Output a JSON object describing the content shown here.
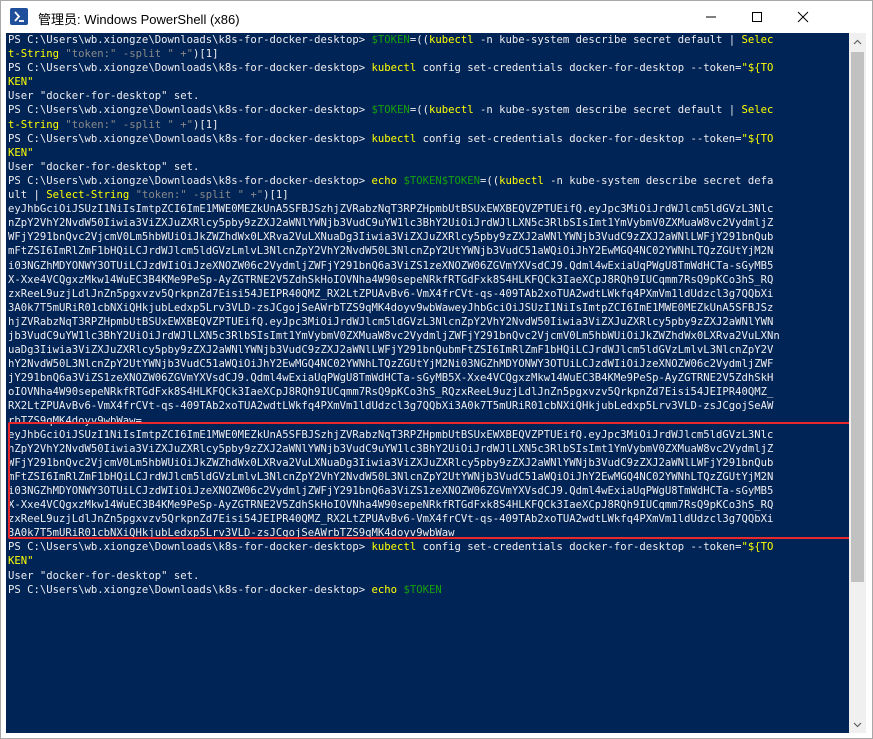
{
  "window": {
    "title": "管理员: Windows PowerShell (x86)",
    "icon": "powershell-icon"
  },
  "titlebar_buttons": [
    "minimize-icon",
    "maximize-icon",
    "close-icon"
  ],
  "console": {
    "prompt": "PS C:\\Users\\wb.xiongze\\Downloads\\k8s-for-docker-desktop>",
    "lines": [
      [
        {
          "t": "PS C:\\Users\\wb.xiongze\\Downloads\\k8s-for-docker-desktop> ",
          "c": "w"
        },
        {
          "t": "$TOKEN",
          "c": "g"
        },
        {
          "t": "=((",
          "c": "w"
        },
        {
          "t": "kubectl",
          "c": "y"
        },
        {
          "t": " -n kube-system describe secret default | ",
          "c": "w"
        },
        {
          "t": "Selec",
          "c": "y"
        }
      ],
      [
        {
          "t": "t-String",
          "c": "y"
        },
        {
          "t": " \"token:\"",
          "c": "gray"
        },
        {
          "t": " -split ",
          "c": "gray"
        },
        {
          "t": "\" +\"",
          "c": "gray"
        },
        {
          "t": ")[1]",
          "c": "w"
        }
      ],
      [
        {
          "t": "PS C:\\Users\\wb.xiongze\\Downloads\\k8s-for-docker-desktop> ",
          "c": "w"
        },
        {
          "t": "kubectl",
          "c": "y"
        },
        {
          "t": " config set-credentials docker-for-desktop --token=",
          "c": "w"
        },
        {
          "t": "\"${TO",
          "c": "y"
        }
      ],
      [
        {
          "t": "KEN",
          "c": "y"
        },
        {
          "t": "\"",
          "c": "y"
        }
      ],
      [
        {
          "t": "User \"docker-for-desktop\" set.",
          "c": "w"
        }
      ],
      [
        {
          "t": "PS C:\\Users\\wb.xiongze\\Downloads\\k8s-for-docker-desktop> ",
          "c": "w"
        },
        {
          "t": "$TOKEN",
          "c": "g"
        },
        {
          "t": "=((",
          "c": "w"
        },
        {
          "t": "kubectl",
          "c": "y"
        },
        {
          "t": " -n kube-system describe secret default | ",
          "c": "w"
        },
        {
          "t": "Selec",
          "c": "y"
        }
      ],
      [
        {
          "t": "t-String",
          "c": "y"
        },
        {
          "t": " \"token:\"",
          "c": "gray"
        },
        {
          "t": " -split ",
          "c": "gray"
        },
        {
          "t": "\" +\"",
          "c": "gray"
        },
        {
          "t": ")[1]",
          "c": "w"
        }
      ],
      [
        {
          "t": "PS C:\\Users\\wb.xiongze\\Downloads\\k8s-for-docker-desktop> ",
          "c": "w"
        },
        {
          "t": "kubectl",
          "c": "y"
        },
        {
          "t": " config set-credentials docker-for-desktop --token=",
          "c": "w"
        },
        {
          "t": "\"${TO",
          "c": "y"
        }
      ],
      [
        {
          "t": "KEN",
          "c": "y"
        },
        {
          "t": "\"",
          "c": "y"
        }
      ],
      [
        {
          "t": "User \"docker-for-desktop\" set.",
          "c": "w"
        }
      ],
      [
        {
          "t": "PS C:\\Users\\wb.xiongze\\Downloads\\k8s-for-docker-desktop> ",
          "c": "w"
        },
        {
          "t": "echo ",
          "c": "y"
        },
        {
          "t": "$TOKEN$TOKEN",
          "c": "g"
        },
        {
          "t": "=((",
          "c": "w"
        },
        {
          "t": "kubectl",
          "c": "y"
        },
        {
          "t": " -n kube-system describe secret defa",
          "c": "w"
        }
      ],
      [
        {
          "t": "ult | ",
          "c": "w"
        },
        {
          "t": "Select-String",
          "c": "y"
        },
        {
          "t": " \"token:\"",
          "c": "gray"
        },
        {
          "t": " -split ",
          "c": "gray"
        },
        {
          "t": "\" +\"",
          "c": "gray"
        },
        {
          "t": ")[1]",
          "c": "w"
        }
      ],
      [
        {
          "t": "eyJhbGciOiJSUzI1NiIsImtpZCI6ImE1MWE0MEZkUnA5SFBJSzhjZVRabzNqT3RPZHpmbUtBSUxEWXBEQVZPTUEifQ.eyJpc3MiOiJrdWJlcm5ldGVzL3Nlc",
          "c": "w"
        }
      ],
      [
        {
          "t": "nZpY2VhY2NvdW50Iiwia3ViZXJuZXRlcy5pby9zZXJ2aWNlYWNjb3VudC9uYW1lc3BhY2UiOiJrdWJlLXN5c3RlbSIsImt1YmVybmV0ZXMuaW8vc2VydmljZ",
          "c": "w"
        }
      ],
      [
        {
          "t": "WFjY291bnQvc2VjcmV0Lm5hbWUiOiJkZWZhdWx0LXRva2VuLXNuaDg3Iiwia3ViZXJuZXRlcy5pby9zZXJ2aWNlYWNjb3VudC9zZXJ2aWNlLWFjY291bnQub",
          "c": "w"
        }
      ],
      [
        {
          "t": "mFtZSI6ImRlZmF1bHQiLCJrdWJlcm5ldGVzLmlvL3NlcnZpY2VhY2NvdW50L3NlcnZpY2UtYWNjb3VudC51aWQiOiJhY2EwMGQ4NC02YWNhLTQzZGUtYjM2N",
          "c": "w"
        }
      ],
      [
        {
          "t": "i03NGZhMDYONWY3OTUiLCJzdWIiOiJzeXNOZW06c2VydmljZWFjY291bnQ6a3ViZS1zeXNOZW06ZGVmYXVsdCJ9.Qdml4wExiaUqPWgU8TmWdHCTa-sGyMB5",
          "c": "w"
        }
      ],
      [
        {
          "t": "X-Xxe4VCQgxzMkw14WuEC3B4KMe9PeSp-AyZGTRNE2V5ZdhSkHoIOVNha4W90sepeNRkfRTGdFxk8S4HLKFQCk3IaeXCpJ8RQh9IUCqmm7RsQ9pKCo3hS_RQ",
          "c": "w"
        }
      ],
      [
        {
          "t": "zxReeL9uzjLdlJnZn5pgxvzv5QrkpnZd7Eisi54JEIPR40QMZ_RX2LtZPUAvBv6-VmX4frCVt-qs-409TAb2xoTUA2wdtLWkfq4PXmVm1ldUdzcl3g7QQbXi",
          "c": "w"
        }
      ],
      [
        {
          "t": "3A0k7T5mURiR01cbNXiQHkjubLedxp5Lrv3VLD-zsJCgojSeAWrbTZS9qMK4doyv9wbWaweyJhbGciOiJSUzI1NiIsImtpZCI6ImE1MWE0MEZkUnA5SFBJSz",
          "c": "w"
        }
      ],
      [
        {
          "t": "hjZVRabzNqT3RPZHpmbUtBSUxEWXBEQVZPTUEifQ.eyJpc3MiOiJrdWJlcm5ldGVzL3NlcnZpY2VhY2NvdW50Iiwia3ViZXJuZXRlcy5pby9zZXJ2aWNlYWN",
          "c": "w"
        }
      ],
      [
        {
          "t": "jb3VudC9uYW1lc3BhY2UiOiJrdWJlLXN5c3RlbSIsImt1YmVybmV0ZXMuaW8vc2VydmljZWFjY291bnQvc2VjcmV0Lm5hbWUiOiJkZWZhdWx0LXRva2VuLXNn",
          "c": "w"
        }
      ],
      [
        {
          "t": "uaDg3Iiwia3ViZXJuZXRlcy5pby9zZXJ2aWNlYWNjb3VudC9zZXJ2aWNlLWFjY291bnQubmFtZSI6ImRlZmF1bHQiLCJrdWJlcm5ldGVzLmlvL3NlcnZpY2V",
          "c": "w"
        }
      ],
      [
        {
          "t": "hY2NvdW50L3NlcnZpY2UtYWNjb3VudC51aWQiOiJhY2EwMGQ4NC02YWNhLTQzZGUtYjM2Ni03NGZhMDYONWY3OTUiLCJzdWIiOiJzeXNOZW06c2VydmljZWF",
          "c": "w"
        }
      ],
      [
        {
          "t": "jY291bnQ6a3ViZS1zeXNOZW06ZGVmYXVsdCJ9.Qdml4wExiaUqPWgU8TmWdHCTa-sGyMB5X-Xxe4VCQgxzMkw14WuEC3B4KMe9PeSp-AyZGTRNE2V5ZdhSkH",
          "c": "w"
        }
      ],
      [
        {
          "t": "oIOVNha4W90sepeNRkfRTGdFxk8S4HLKFQCk3IaeXCpJ8RQh9IUCqmm7RsQ9pKCo3hS_RQzxReeL9uzjLdlJnZn5pgxvzv5QrkpnZd7Eisi54JEIPR40QMZ_",
          "c": "w"
        }
      ],
      [
        {
          "t": "RX2LtZPUAvBv6-VmX4frCVt-qs-409TAb2xoTUA2wdtLWkfq4PXmVm1ldUdzcl3g7QQbXi3A0k7T5mURiR01cbNXiQHkjubLedxp5Lrv3VLD-zsJCgojSeAW",
          "c": "w"
        }
      ],
      [
        {
          "t": "rbTZS9qMK4doyv9wbWaw=",
          "c": "w"
        }
      ],
      [
        {
          "t": "eyJhbGciOiJSUzI1NiIsImtpZCI6ImE1MWE0MEZkUnA5SFBJSzhjZVRabzNqT3RPZHpmbUtBSUxEWXBEQVZPTUEifQ.eyJpc3MiOiJrdWJlcm5ldGVzL3Nlc",
          "c": "w"
        }
      ],
      [
        {
          "t": "nZpY2VhY2NvdW50Iiwia3ViZXJuZXRlcy5pby9zZXJ2aWNlYWNjb3VudC9uYW1lc3BhY2UiOiJrdWJlLXN5c3RlbSIsImt1YmVybmV0ZXMuaW8vc2VydmljZ",
          "c": "w"
        }
      ],
      [
        {
          "t": "WFjY291bnQvc2VjcmV0Lm5hbWUiOiJkZWZhdWx0LXRva2VuLXNuaDg3Iiwia3ViZXJuZXRlcy5pby9zZXJ2aWNlYWNjb3VudC9zZXJ2aWNlLWFjY291bnQub",
          "c": "w"
        }
      ],
      [
        {
          "t": "mFtZSI6ImRlZmF1bHQiLCJrdWJlcm5ldGVzLmlvL3NlcnZpY2VhY2NvdW50L3NlcnZpY2UtYWNjb3VudC51aWQiOiJhY2EwMGQ4NC02YWNhLTQzZGUtYjM2N",
          "c": "w"
        }
      ],
      [
        {
          "t": "i03NGZhMDYONWY3OTUiLCJzdWIiOiJzeXNOZW06c2VydmljZWFjY291bnQ6a3ViZS1zeXNOZW06ZGVmYXVsdCJ9.Qdml4wExiaUqPWgU8TmWdHCTa-sGyMB5",
          "c": "w"
        }
      ],
      [
        {
          "t": "X-Xxe4VCQgxzMkw14WuEC3B4KMe9PeSp-AyZGTRNE2V5ZdhSkHoIOVNha4W90sepeNRkfRTGdFxk8S4HLKFQCk3IaeXCpJ8RQh9IUCqmm7RsQ9pKCo3hS_RQ",
          "c": "w"
        }
      ],
      [
        {
          "t": "zxReeL9uzjLdlJnZn5pgxvzv5QrkpnZd7Eisi54JEIPR40QMZ_RX2LtZPUAvBv6-VmX4frCVt-qs-409TAb2xoTUA2wdtLWkfq4PXmVm1ldUdzcl3g7QQbXi",
          "c": "w"
        }
      ],
      [
        {
          "t": "3A0k7T5mURiR01cbNXiQHkjubLedxp5Lrv3VLD-zsJCgojSeAWrbTZS9qMK4doyv9wbWaw",
          "c": "w"
        }
      ],
      [
        {
          "t": "PS C:\\Users\\wb.xiongze\\Downloads\\k8s-for-docker-desktop> ",
          "c": "w"
        },
        {
          "t": "kubectl",
          "c": "y"
        },
        {
          "t": " config set-credentials docker-for-desktop --token=",
          "c": "w"
        },
        {
          "t": "\"${TO",
          "c": "y"
        }
      ],
      [
        {
          "t": "KEN",
          "c": "y"
        },
        {
          "t": "\"",
          "c": "y"
        }
      ],
      [
        {
          "t": "User \"docker-for-desktop\" set.",
          "c": "w"
        }
      ],
      [
        {
          "t": "PS C:\\Users\\wb.xiongze\\Downloads\\k8s-for-docker-desktop> ",
          "c": "w"
        },
        {
          "t": "echo ",
          "c": "y"
        },
        {
          "t": "$TOKEN",
          "c": "g"
        }
      ]
    ]
  },
  "colors": {
    "console_bg": "#012456",
    "text": "#eeedf0",
    "command": "#ffff00",
    "variable": "#13a10e",
    "string": "#8a8a8a",
    "highlight_border": "#e8282b"
  }
}
